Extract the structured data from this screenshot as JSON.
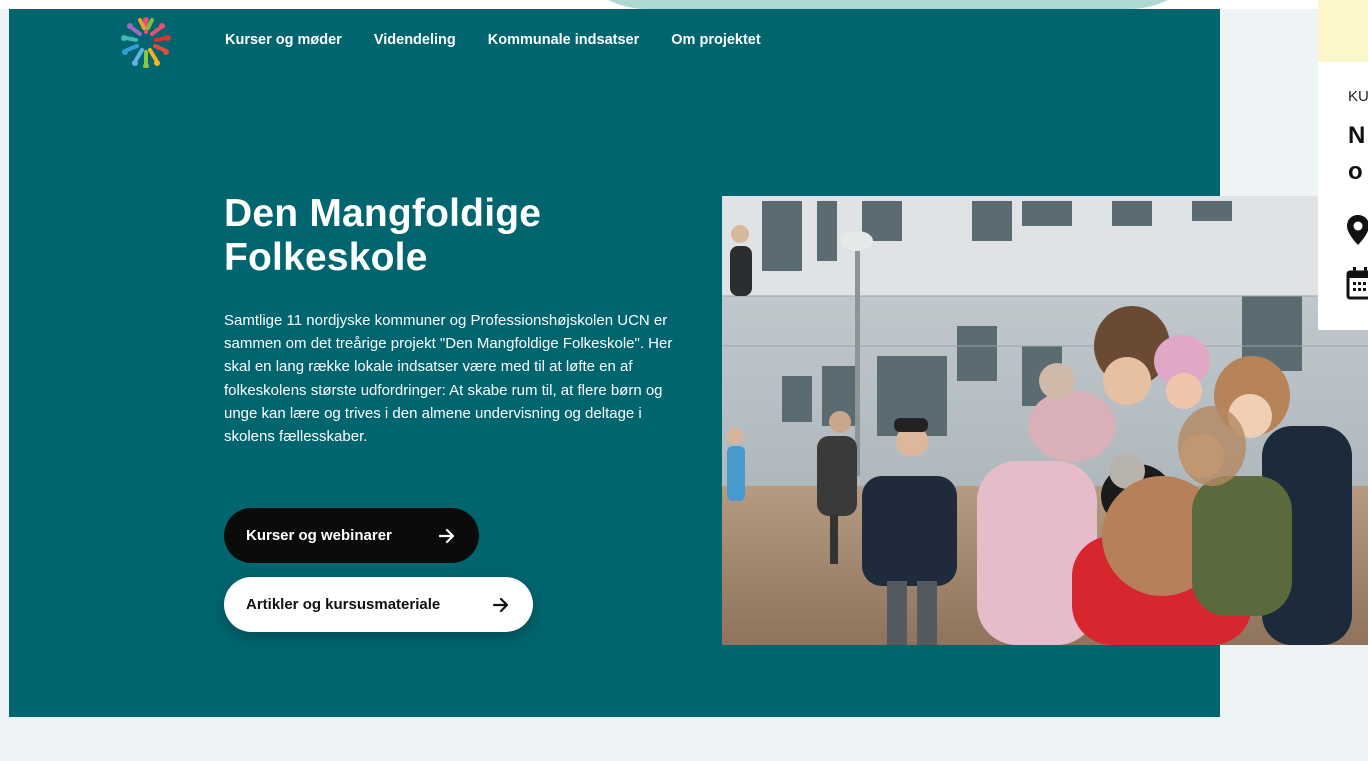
{
  "nav": {
    "items": [
      {
        "label": "Kurser og møder"
      },
      {
        "label": "Videndeling"
      },
      {
        "label": "Kommunale indsatser"
      },
      {
        "label": "Om projektet"
      }
    ]
  },
  "hero": {
    "title": "Den Mangfoldige Folkeskole",
    "text": "Samtlige 11 nordjyske kommuner og Professionshøjskolen UCN er sammen om det treårige projekt \"Den Mangfoldige Folkeskole\". Her skal en lang række lokale indsatser være med til at løfte en af folkeskolens største udfordringer: At skabe rum til, at flere børn og unge kan lære og trives i den almene undervisning og deltage i skolens fællesskaber.",
    "primary_button": "Kurser og webinarer",
    "secondary_button": "Artikler og kursusmateriale"
  },
  "side_card": {
    "kicker": "KU",
    "title": "N\no"
  },
  "colors": {
    "hero_bg": "#00656f",
    "page_bg": "#eef4f6",
    "button_dark": "#0b0b0b",
    "side_accent": "#fdf6c9"
  },
  "icons": [
    "logo-people-circle",
    "arrow-right-icon",
    "map-pin-icon",
    "calendar-icon"
  ]
}
